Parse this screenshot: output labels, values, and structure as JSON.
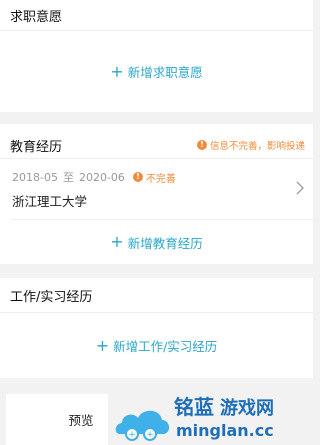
{
  "job_intention": {
    "title": "求职意愿",
    "add_label": "新增求职意愿"
  },
  "education": {
    "title": "教育经历",
    "warning": "信息不完善，影响投递",
    "item": {
      "start": "2018-05",
      "to": "至",
      "end": "2020-06",
      "status": "不完善",
      "school": "浙江理工大学"
    },
    "add_label": "新增教育经历"
  },
  "work": {
    "title": "工作/实习经历",
    "add_label": "新增工作/实习经历"
  },
  "footer": {
    "preview_label": "预览"
  },
  "watermark": {
    "brand": "铭蓝",
    "sub": "游戏网",
    "domain": "minglan.cc"
  },
  "colors": {
    "accent": "#2aa7c9",
    "warning": "#f08a3c"
  }
}
